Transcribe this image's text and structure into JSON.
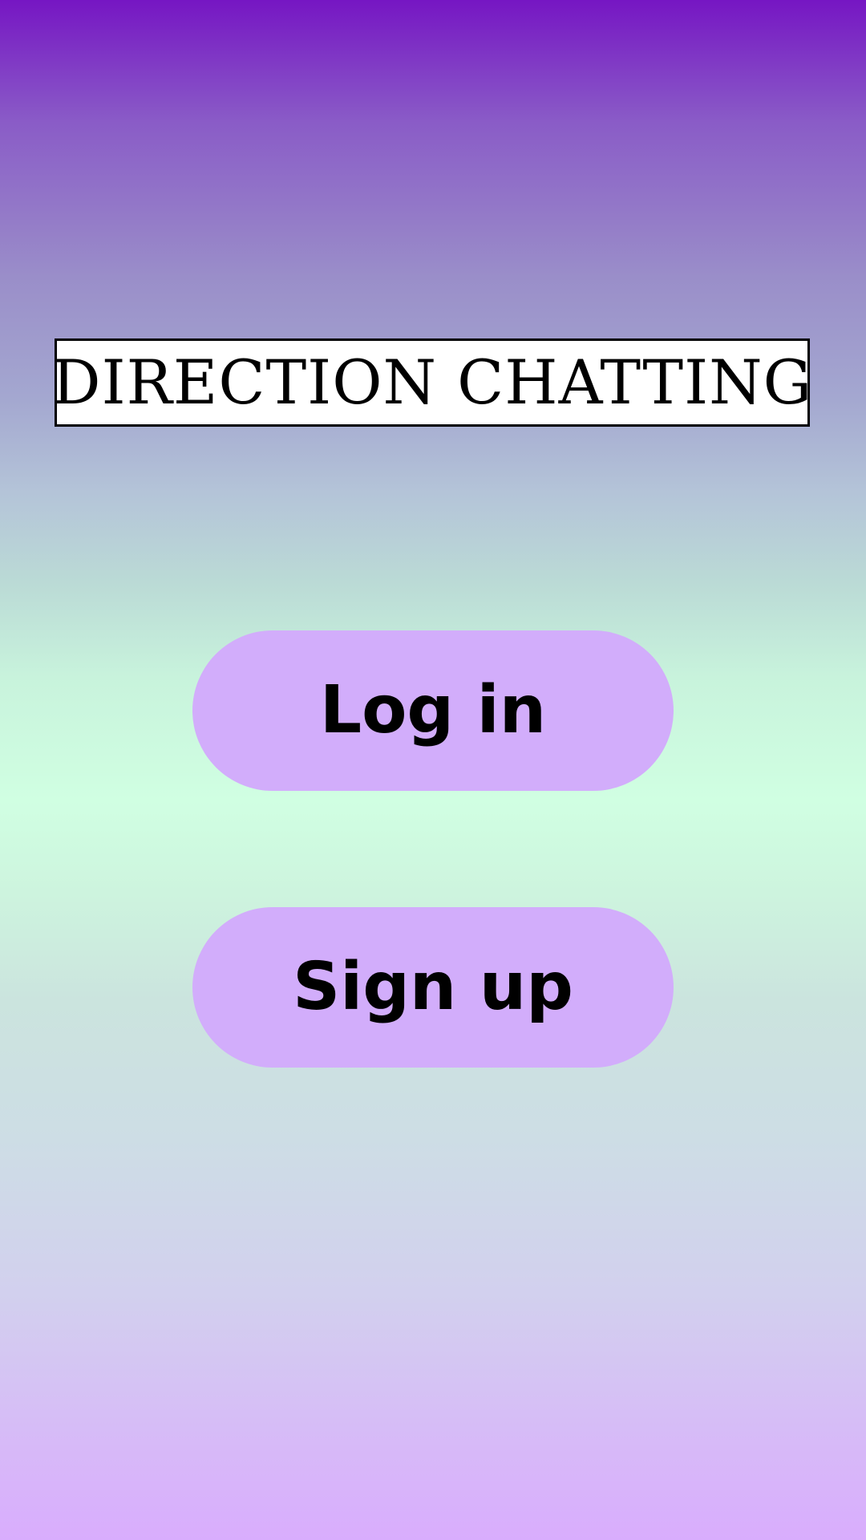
{
  "app": {
    "title": "DIRECTION CHATTING"
  },
  "actions": {
    "login_label": "Log in",
    "signup_label": "Sign up"
  },
  "colors": {
    "background_top": "#7616c3",
    "background_middle": "#d0ffe2",
    "background_bottom": "#d9adfd",
    "button_fill": "#d2adfb",
    "title_box_fill": "#ffffff",
    "text": "#000000"
  }
}
